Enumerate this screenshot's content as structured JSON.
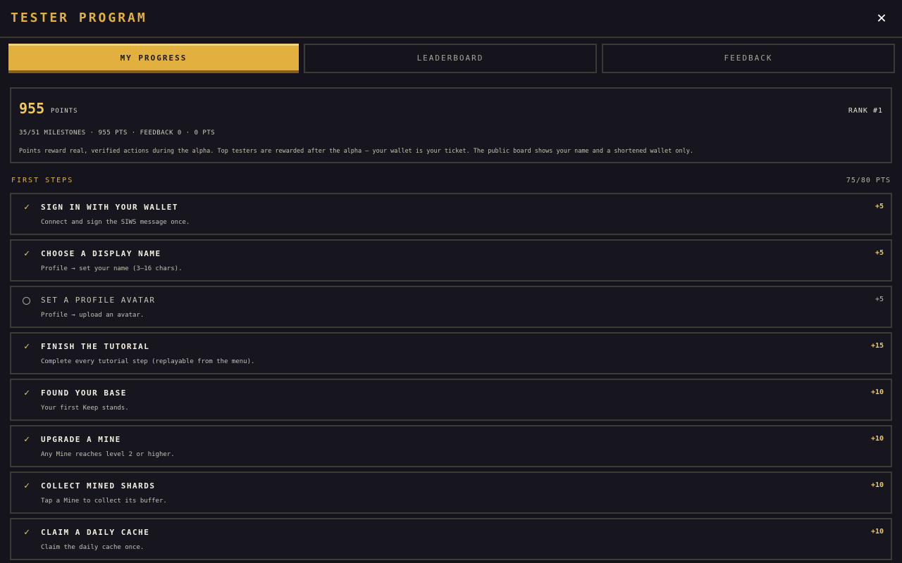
{
  "header": {
    "title": "TESTER PROGRAM",
    "close_glyph": "✕"
  },
  "tabs": [
    {
      "label": "MY PROGRESS",
      "active": true
    },
    {
      "label": "LEADERBOARD",
      "active": false
    },
    {
      "label": "FEEDBACK",
      "active": false
    }
  ],
  "summary": {
    "points": "955",
    "points_label": "POINTS",
    "rank": "RANK #1",
    "stats": "35/51 MILESTONES · 955 PTS · FEEDBACK 0 · 0 PTS",
    "description": "Points reward real, verified actions during the alpha. Top testers are rewarded after the alpha — your wallet is your ticket. The public board shows your name and a shortened wallet only."
  },
  "section": {
    "title": "FIRST STEPS",
    "score": "75/80 PTS"
  },
  "colors": {
    "accent": "#e2b03e",
    "background": "#15141d",
    "border": "#3d3b36"
  },
  "items": [
    {
      "title": "SIGN IN WITH YOUR WALLET",
      "desc": "Connect and sign the SIWS message once.",
      "pts": "+5",
      "done": true
    },
    {
      "title": "CHOOSE A DISPLAY NAME",
      "desc": "Profile → set your name (3–16 chars).",
      "pts": "+5",
      "done": true
    },
    {
      "title": "SET A PROFILE AVATAR",
      "desc": "Profile → upload an avatar.",
      "pts": "+5",
      "done": false
    },
    {
      "title": "FINISH THE TUTORIAL",
      "desc": "Complete every tutorial step (replayable from the menu).",
      "pts": "+15",
      "done": true
    },
    {
      "title": "FOUND YOUR BASE",
      "desc": "Your first Keep stands.",
      "pts": "+10",
      "done": true
    },
    {
      "title": "UPGRADE A MINE",
      "desc": "Any Mine reaches level 2 or higher.",
      "pts": "+10",
      "done": true
    },
    {
      "title": "COLLECT MINED SHARDS",
      "desc": "Tap a Mine to collect its buffer.",
      "pts": "+10",
      "done": true
    },
    {
      "title": "CLAIM A DAILY CACHE",
      "desc": "Claim the daily cache once.",
      "pts": "+10",
      "done": true
    }
  ]
}
